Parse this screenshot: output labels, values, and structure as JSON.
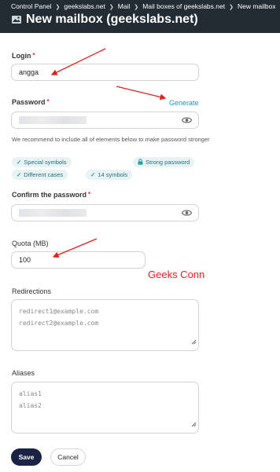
{
  "breadcrumb": [
    "Control Panel",
    "geekslabs.net",
    "Mail",
    "Mail boxes of geekslabs.net",
    "New mailbox"
  ],
  "page_title": "New mailbox (geekslabs.net)",
  "form": {
    "login": {
      "label": "Login",
      "value": "angga"
    },
    "password": {
      "label": "Password",
      "generate_label": "Generate"
    },
    "hint": "We recommend to include all of elements below to make password stronger",
    "requirements": [
      "Special symbols",
      "Strong password",
      "Different cases",
      "14 symbols"
    ],
    "confirm": {
      "label": "Confirm the password"
    },
    "quota": {
      "label": "Quota (MB)",
      "value": "100"
    },
    "redirections": {
      "label": "Redirections",
      "placeholder": "redirect1@example.com\nredirect2@example.com"
    },
    "aliases": {
      "label": "Aliases",
      "placeholder": "alias1\nalias2"
    }
  },
  "buttons": {
    "save": "Save",
    "cancel": "Cancel"
  },
  "watermark": "Geeks Conn",
  "colors": {
    "header_bg": "#232b33",
    "accent": "#1b9ac5",
    "save_bg": "#1a2344",
    "required": "#d33333",
    "annotation": "#e02020"
  }
}
